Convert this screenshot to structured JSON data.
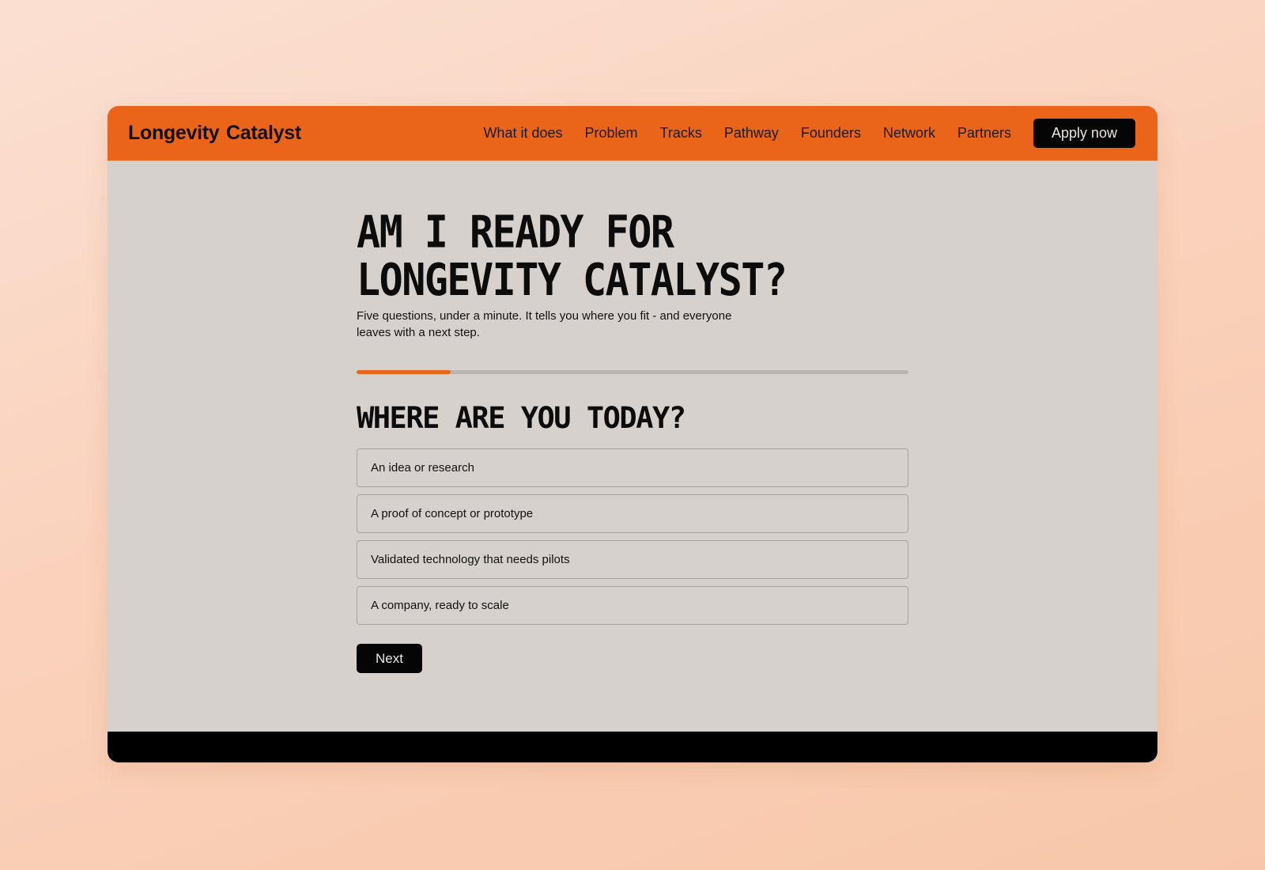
{
  "header": {
    "brand": "Longevity Catalyst",
    "nav": [
      "What it does",
      "Problem",
      "Tracks",
      "Pathway",
      "Founders",
      "Network",
      "Partners"
    ],
    "apply_label": "Apply now"
  },
  "hero": {
    "title": "AM I READY FOR\nLONGEVITY CATALYST?",
    "subtitle": "Five questions, under a minute. It tells you where you fit - and everyone leaves with a next step."
  },
  "progress": {
    "fraction": 0.17
  },
  "quiz": {
    "question": "WHERE ARE YOU TODAY?",
    "options": [
      "An idea or research",
      "A proof of concept or prototype",
      "Validated technology that needs pilots",
      "A company, ready to scale"
    ],
    "next_label": "Next"
  },
  "colors": {
    "accent": "#ea6519",
    "surface": "#d6d1cd",
    "ink": "#050505"
  }
}
